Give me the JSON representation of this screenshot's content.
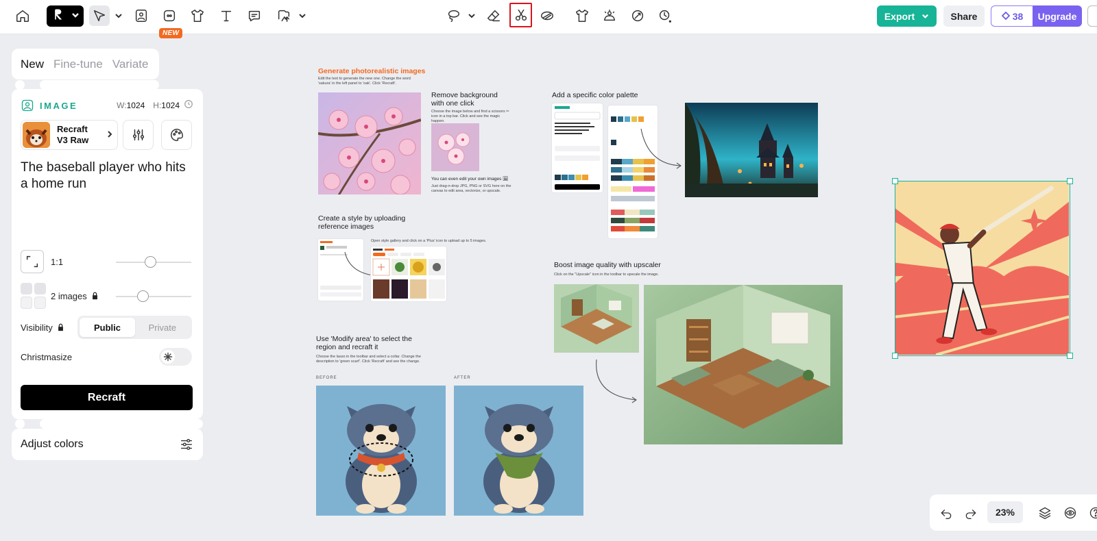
{
  "toolbar": {
    "new_badge": "NEW",
    "export_label": "Export",
    "share_label": "Share",
    "credits": "38",
    "upgrade_label": "Upgrade",
    "icons": [
      "home-icon",
      "recraft-logo",
      "select-arrow-icon",
      "image-icon",
      "vector-icon",
      "mockup-icon",
      "text-icon",
      "comment-icon",
      "frame-import-icon",
      "lasso-icon",
      "eraser-icon",
      "scissors-icon",
      "vectorize-icon",
      "shirt-icon",
      "generate-icon",
      "inpaint-icon",
      "pin-icon"
    ],
    "colors": {
      "accent": "#17b497",
      "upgrade": "#7a62f0",
      "badge": "#f26a21",
      "active_outline": "#d6151b"
    }
  },
  "mode_tabs": [
    {
      "label": "New",
      "active": true
    },
    {
      "label": "Fine-tune",
      "active": false
    },
    {
      "label": "Variate",
      "active": false
    }
  ],
  "panel": {
    "section_label": "IMAGE",
    "width_prefix": "W:",
    "width": "1024",
    "height_prefix": "H:",
    "height": "1024",
    "model_line1": "Recraft",
    "model_line2": "V3 Raw",
    "prompt": "The baseball player who hits a home run",
    "ratio_label": "1:1",
    "images_label": "2 images",
    "ratio_slider": 0.45,
    "images_slider": 0.35,
    "visibility_label": "Visibility",
    "public_label": "Public",
    "private_label": "Private",
    "christmasize_label": "Christmasize",
    "recraft_label": "Recraft",
    "adjust_colors_label": "Adjust colors"
  },
  "canvas": {
    "gen_title": "Generate photorealistic images",
    "gen_desc": "Edit the text to generate the new one. Change the word 'sakura' in the left panel to 'oak'. Click 'Recraft'.",
    "remove_bg_title": "Remove background with one click",
    "remove_bg_desc": "Choose the image below and find a scissors ✂ icon in a top bar. Click and see the magic happen.",
    "own_images_title": "You can even edit your own images 🖼",
    "own_images_desc": "Just drag-n-drop JPG, PNG or SVG here on the canvas to edit area, vectorize, or upscale.",
    "palette_title": "Add a specific color palette",
    "style_title": "Create a style by uploading reference images",
    "style_desc": "Open style gallery and click on a 'Plus' icon to upload up to 5 images.",
    "upscale_title": "Boost image quality with upscaler",
    "upscale_desc": "Click on the \"Upscale\" icon in the toolbar to upscale the image.",
    "modify_title": "Use 'Modify area' to select the region  and recraft it",
    "modify_desc": "Choose the lasso in the toolbar and select a collar. Change the description to 'green scarf'. Click 'Recraft' and see the change.",
    "before_label": "BEFORE",
    "after_label": "AFTER"
  },
  "zoom": {
    "value": "23%"
  }
}
